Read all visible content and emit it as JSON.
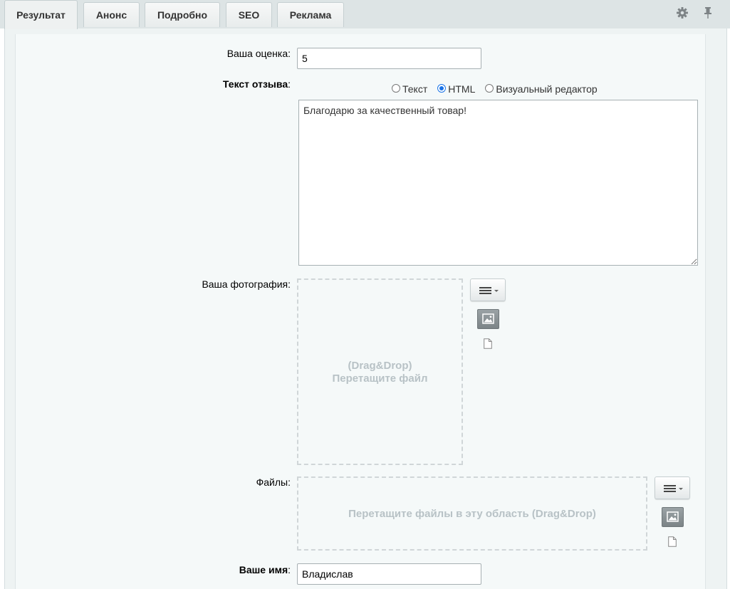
{
  "tabs": [
    {
      "label": "Результат",
      "active": true
    },
    {
      "label": "Анонс"
    },
    {
      "label": "Подробно"
    },
    {
      "label": "SEO"
    },
    {
      "label": "Реклама"
    }
  ],
  "toolbar": {
    "settings_icon": "gear-icon",
    "pin_icon": "pin-icon"
  },
  "form": {
    "rating": {
      "label": "Ваша оценка",
      "value": "5"
    },
    "review": {
      "label": "Текст отзыва",
      "modes": [
        {
          "label": "Текст",
          "checked": false
        },
        {
          "label": "HTML",
          "checked": true
        },
        {
          "label": "Визуальный редактор",
          "checked": false
        }
      ],
      "value": "Благодарю за качественный товар!"
    },
    "photo": {
      "label": "Ваша фотография",
      "drop_line1": "(Drag&Drop)",
      "drop_line2": "Перетащите файл"
    },
    "files": {
      "label": "Файлы",
      "drop_text": "Перетащите файлы в эту область (Drag&Drop)"
    },
    "name": {
      "label": "Ваше имя",
      "value": "Владислав"
    }
  },
  "colors": {
    "accent": "#1a73e8",
    "panel_bg": "#eef3f3",
    "drop_text": "#b8c2c6"
  }
}
